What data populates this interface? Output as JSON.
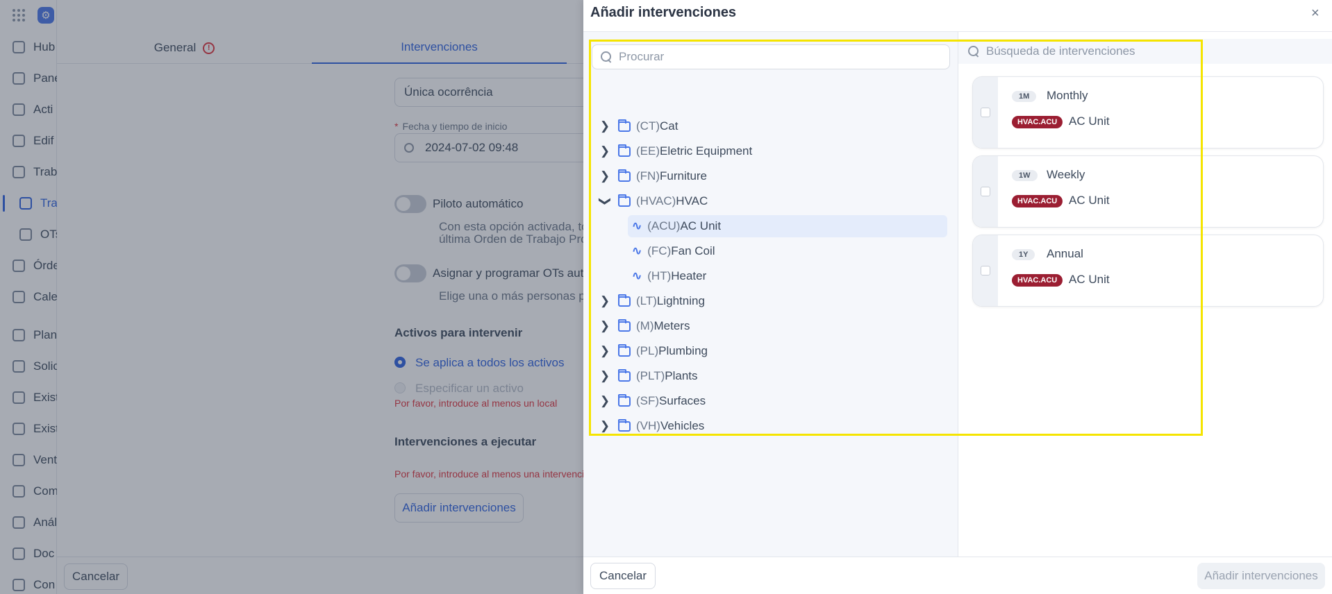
{
  "sidebar": {
    "items": [
      {
        "label": "Hub",
        "icon": "clock-icon"
      },
      {
        "label": "Pane",
        "icon": "dashboard-icon"
      },
      {
        "label": "Acti",
        "icon": "pulse-icon"
      },
      {
        "label": "Edif",
        "icon": "building-icon"
      },
      {
        "label": "Trab",
        "icon": "calendar-icon"
      },
      {
        "label": "Tra",
        "icon": "calendar-icon"
      },
      {
        "label": "OTs",
        "icon": "clipboard-icon"
      },
      {
        "label": "Órde",
        "icon": "clipboard-icon"
      },
      {
        "label": "Cale",
        "icon": "calendar-icon"
      },
      {
        "label": "Plan",
        "icon": "calendar-icon"
      },
      {
        "label": "Solic",
        "icon": "bell-icon"
      },
      {
        "label": "Exist",
        "icon": "list-icon"
      },
      {
        "label": "Exist",
        "icon": "list-icon"
      },
      {
        "label": "Vent",
        "icon": "tag-icon"
      },
      {
        "label": "Com",
        "icon": "cart-icon"
      },
      {
        "label": "Anál",
        "icon": "chart-icon"
      },
      {
        "label": "Doc",
        "icon": "document-icon"
      },
      {
        "label": "Con",
        "icon": "plug-icon"
      }
    ]
  },
  "tabs": {
    "general": "General",
    "interventions": "Intervenciones"
  },
  "form": {
    "occurrence": "Única ocorrência",
    "start_label": "Fecha y tiempo de inicio",
    "start_value": "2024-07-02 09:48",
    "autopilot_label": "Piloto automático",
    "autopilot_desc_1": "Con esta opción activada, to",
    "autopilot_desc_2": "última Orden de Trabajo Proc",
    "assign_label": "Asignar y programar OTs auto",
    "assign_desc": "Elige una o más personas pa",
    "assets_heading": "Activos para intervenir",
    "assets_all": "Se aplica a todos los activos",
    "assets_specific": "Especificar un activo",
    "assets_error": "Por favor, introduce al menos un local",
    "interventions_heading": "Intervenciones a ejecutar",
    "interventions_error": "Por favor, introduce al menos una intervenció",
    "add_interventions": "Añadir intervenciones",
    "cancel": "Cancelar"
  },
  "drawer": {
    "title": "Añadir intervenciones",
    "close": "×",
    "search_placeholder": "Procurar",
    "interventions_search_placeholder": "Búsqueda de intervenciones",
    "tree": [
      {
        "code": "(CT)",
        "name": "Cat"
      },
      {
        "code": "(EE)",
        "name": "Eletric Equipment"
      },
      {
        "code": "(FN)",
        "name": "Furniture"
      },
      {
        "code": "(HVAC)",
        "name": "HVAC"
      },
      {
        "code": "(LT)",
        "name": "Lightning"
      },
      {
        "code": "(M)",
        "name": "Meters"
      },
      {
        "code": "(PL)",
        "name": "Plumbing"
      },
      {
        "code": "(PLT)",
        "name": "Plants"
      },
      {
        "code": "(SF)",
        "name": "Surfaces"
      },
      {
        "code": "(VH)",
        "name": "Vehicles"
      }
    ],
    "hvac_children": [
      {
        "code": "(ACU)",
        "name": "AC Unit"
      },
      {
        "code": "(FC)",
        "name": "Fan Coil"
      },
      {
        "code": "(HT)",
        "name": "Heater"
      }
    ],
    "cards": [
      {
        "freq": "1M",
        "name": "Monthly",
        "tag": "HVAC.ACU",
        "asset": "AC Unit"
      },
      {
        "freq": "1W",
        "name": "Weekly",
        "tag": "HVAC.ACU",
        "asset": "AC Unit"
      },
      {
        "freq": "1Y",
        "name": "Annual",
        "tag": "HVAC.ACU",
        "asset": "AC Unit"
      }
    ],
    "cancel": "Cancelar",
    "add": "Añadir intervenciones"
  },
  "colors": {
    "accent": "#2f63e0",
    "tag": "#9b1e32",
    "highlight": "#f5e400",
    "error": "#e0343e"
  }
}
